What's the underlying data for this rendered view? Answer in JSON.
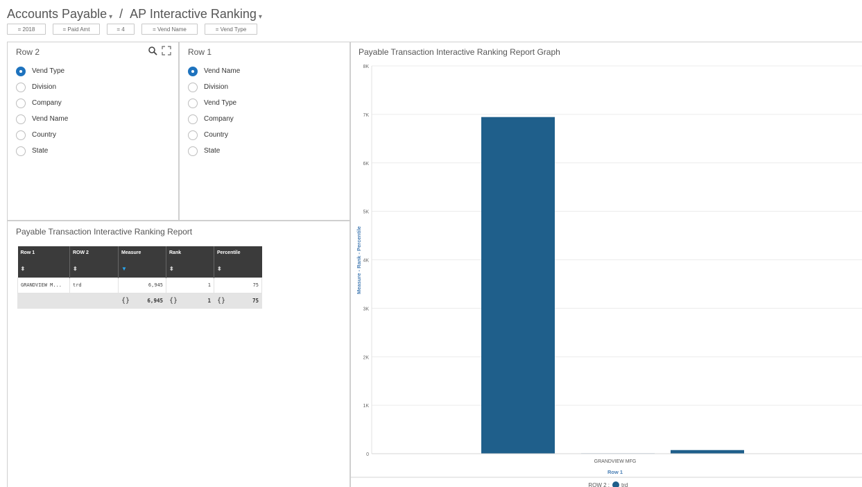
{
  "header": {
    "crumb1": "Accounts Payable",
    "separator": "/",
    "crumb2": "AP Interactive Ranking"
  },
  "filters": [
    "= 2018",
    "= Paid Amt",
    "= 4",
    "= Vend Name",
    "= Vend Type"
  ],
  "row2_panel": {
    "title": "Row 2",
    "options": [
      "Vend Type",
      "Division",
      "Company",
      "Vend Name",
      "Country",
      "State"
    ],
    "selected_index": 0
  },
  "row1_panel": {
    "title": "Row 1",
    "options": [
      "Vend Name",
      "Division",
      "Vend Type",
      "Company",
      "Country",
      "State"
    ],
    "selected_index": 0
  },
  "report": {
    "title": "Payable Transaction Interactive Ranking Report",
    "columns": [
      "Row 1",
      "ROW 2",
      "Measure",
      "Rank",
      "Percentile"
    ],
    "sorted_column": 2,
    "rows": [
      [
        "GRANDVIEW M...",
        "trd",
        "6,945",
        "1",
        "75"
      ]
    ],
    "totals": {
      "brace": "{}",
      "measure": "6,945",
      "rank": "1",
      "percentile": "75"
    }
  },
  "graph": {
    "title": "Payable Transaction Interactive Ranking Report Graph",
    "legend_prefix": "ROW 2 :",
    "colors": {
      "bar": "#1f5f8b",
      "accent": "#1e73be",
      "axis_label": "#4a7fb5"
    }
  },
  "chart_data": {
    "type": "bar",
    "title": "Payable Transaction Interactive Ranking Report Graph",
    "categories": [
      "GRANDVIEW MFG"
    ],
    "xlabel": "Row 1",
    "ylabel": "Measure - Rank - Percentile",
    "ylim": [
      0,
      8000
    ],
    "yticks": [
      0,
      1000,
      2000,
      3000,
      4000,
      5000,
      6000,
      7000,
      8000
    ],
    "ytick_labels": [
      "0",
      "1K",
      "2K",
      "3K",
      "4K",
      "5K",
      "6K",
      "7K",
      "8K"
    ],
    "series": [
      {
        "name": "trd",
        "values": [
          6945,
          1,
          75
        ]
      }
    ],
    "bar_groups": [
      "Measure",
      "Rank",
      "Percentile"
    ],
    "grid": true,
    "legend": "bottom"
  }
}
